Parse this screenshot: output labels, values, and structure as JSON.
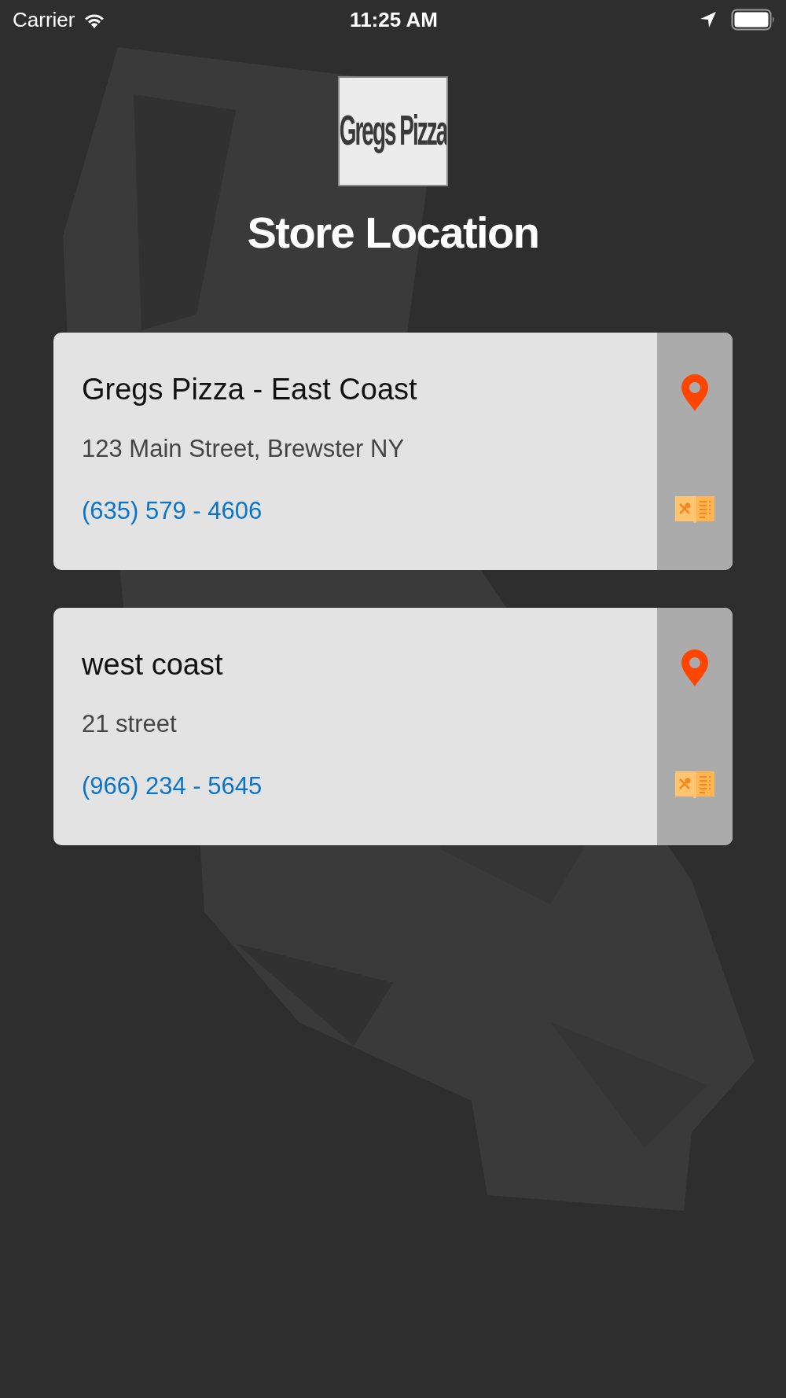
{
  "status_bar": {
    "carrier": "Carrier",
    "time": "11:25 AM"
  },
  "logo": {
    "text": "Gregs Pizza"
  },
  "title": "Store Location",
  "stores": [
    {
      "name": "Gregs Pizza - East Coast",
      "address": "123 Main Street, Brewster NY",
      "phone": "(635) 579 - 4606"
    },
    {
      "name": "west coast",
      "address": "21 street",
      "phone": "(966) 234 - 5645"
    }
  ]
}
